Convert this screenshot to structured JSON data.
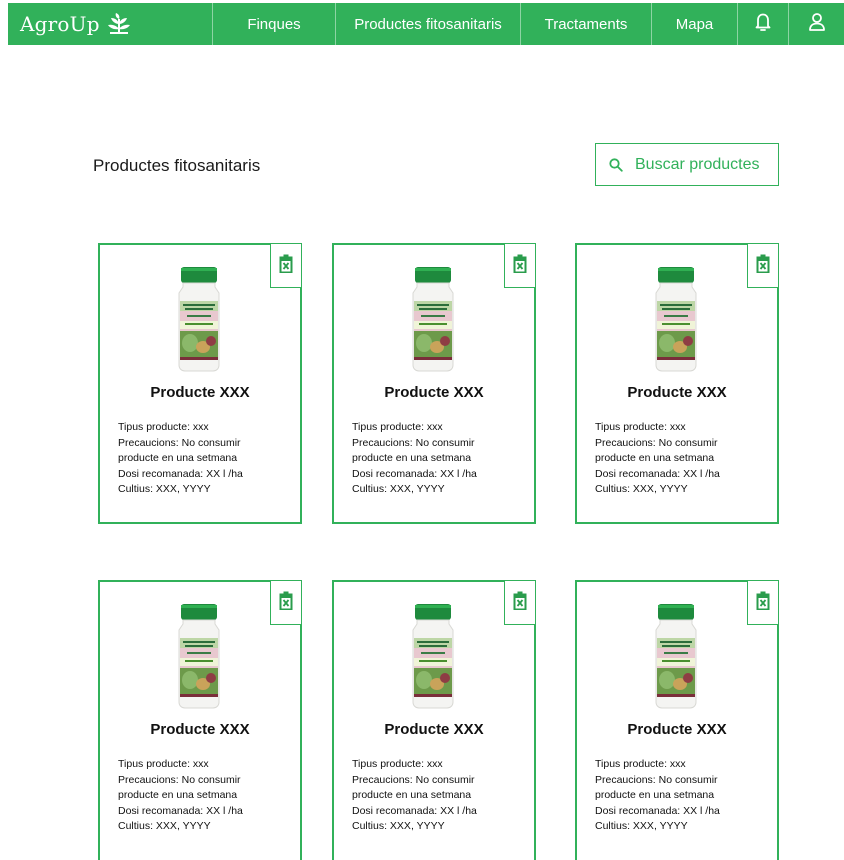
{
  "nav": {
    "brand": "AgroUp",
    "items": [
      "Finques",
      "Productes fitosanitaris",
      "Tractaments",
      "Mapa"
    ]
  },
  "page": {
    "title": "Productes fitosanitaris",
    "search_label": "Buscar productes"
  },
  "colors": {
    "accent": "#31b15a",
    "bottle_cap": "#1e8a3d",
    "bottle_body": "#f4f4f2"
  },
  "products": [
    {
      "name": "Producte XXX",
      "tipus": "Tipus producte: xxx",
      "precaucions_1": "Precaucions: No consumir",
      "precaucions_2": "producte en una setmana",
      "dosi": "Dosi recomanada: XX l /ha",
      "cultius": "Cultius: XXX, YYYY"
    },
    {
      "name": "Producte XXX",
      "tipus": "Tipus producte: xxx",
      "precaucions_1": "Precaucions: No consumir",
      "precaucions_2": "producte en una setmana",
      "dosi": "Dosi recomanada: XX l /ha",
      "cultius": "Cultius: XXX, YYYY"
    },
    {
      "name": "Producte XXX",
      "tipus": "Tipus producte: xxx",
      "precaucions_1": "Precaucions: No consumir",
      "precaucions_2": "producte en una setmana",
      "dosi": "Dosi recomanada: XX l /ha",
      "cultius": "Cultius: XXX, YYYY"
    },
    {
      "name": "Producte XXX",
      "tipus": "Tipus producte: xxx",
      "precaucions_1": "Precaucions: No consumir",
      "precaucions_2": "producte en una setmana",
      "dosi": "Dosi recomanada: XX l /ha",
      "cultius": "Cultius: XXX, YYYY"
    },
    {
      "name": "Producte XXX",
      "tipus": "Tipus producte: xxx",
      "precaucions_1": "Precaucions: No consumir",
      "precaucions_2": "producte en una setmana",
      "dosi": "Dosi recomanada: XX l /ha",
      "cultius": "Cultius: XXX, YYYY"
    },
    {
      "name": "Producte XXX",
      "tipus": "Tipus producte: xxx",
      "precaucions_1": "Precaucions: No consumir",
      "precaucions_2": "producte en una setmana",
      "dosi": "Dosi recomanada: XX l /ha",
      "cultius": "Cultius: XXX, YYYY"
    }
  ]
}
